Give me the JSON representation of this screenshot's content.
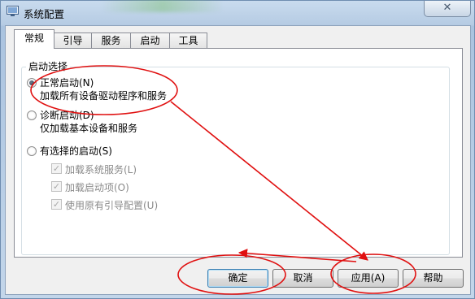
{
  "window": {
    "title": "系统配置",
    "close_glyph": "✕"
  },
  "tabs": [
    "常规",
    "引导",
    "服务",
    "启动",
    "工具"
  ],
  "group": {
    "legend": "启动选择",
    "options": [
      {
        "label": "正常启动(N)",
        "desc": "加载所有设备驱动程序和服务",
        "checked": true
      },
      {
        "label": "诊断启动(D)",
        "desc": "仅加载基本设备和服务",
        "checked": false
      },
      {
        "label": "有选择的启动(S)",
        "desc": "",
        "checked": false
      }
    ],
    "sub_options": [
      "加载系统服务(L)",
      "加载启动项(O)",
      "使用原有引导配置(U)"
    ]
  },
  "buttons": {
    "ok": "确定",
    "cancel": "取消",
    "apply": "应用(A)",
    "help": "帮助"
  },
  "annotation_color": "#e01010"
}
